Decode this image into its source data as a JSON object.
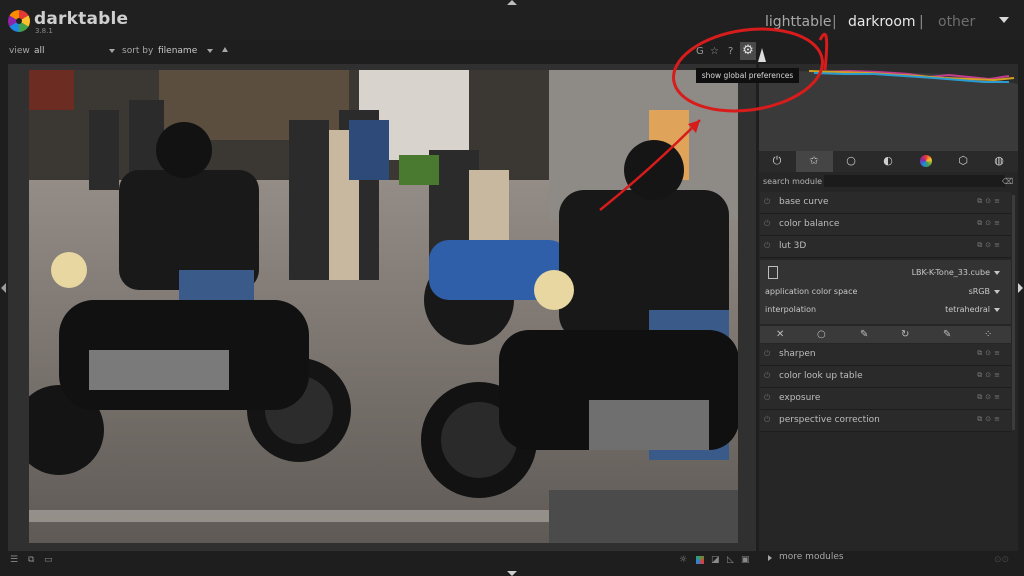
{
  "colors": {
    "accent_red": "#d81b1b",
    "bg": "#1e1e1e",
    "panel": "#262626"
  },
  "app": {
    "name": "darktable",
    "version": "3.8.1"
  },
  "views": {
    "lighttable": "lighttable",
    "sep1": "|",
    "darkroom": "darkroom",
    "sep2": "|",
    "other": "other"
  },
  "filterbar": {
    "view_label": "view",
    "view_value": "all",
    "sort_label": "sort by",
    "sort_value": "filename",
    "sort_dir_icon": "sort-ascending-icon"
  },
  "top_icons": {
    "grouping": "G",
    "overlay_star": "☆",
    "help": "?",
    "prefs_icon": "gear-icon"
  },
  "tooltip": "show global preferences",
  "photo": {
    "description_icon": "photo-motorcyclists"
  },
  "module_groups": {
    "icons": [
      "power-icon",
      "star-icon",
      "circle-icon",
      "half-circle-icon",
      "color-wheel-icon",
      "shape-icon",
      "texture-icon"
    ]
  },
  "search": {
    "label": "search module",
    "placeholder": ""
  },
  "modules_top": [
    {
      "name": "base curve"
    },
    {
      "name": "color balance"
    },
    {
      "name": "lut 3D"
    }
  ],
  "lut": {
    "file": "LBK-K-Tone_33.cube",
    "color_space_label": "application color space",
    "color_space_value": "sRGB",
    "interp_label": "interpolation",
    "interp_value": "tetrahedral"
  },
  "blend_icons": [
    "off-icon",
    "uniform-icon",
    "drawn-mask-icon",
    "parametric-mask-icon",
    "drawn-parametric-icon",
    "raster-mask-icon"
  ],
  "modules_bottom": [
    {
      "name": "sharpen"
    },
    {
      "name": "color look up table"
    },
    {
      "name": "exposure"
    },
    {
      "name": "perspective correction"
    }
  ],
  "more_modules": "more modules"
}
